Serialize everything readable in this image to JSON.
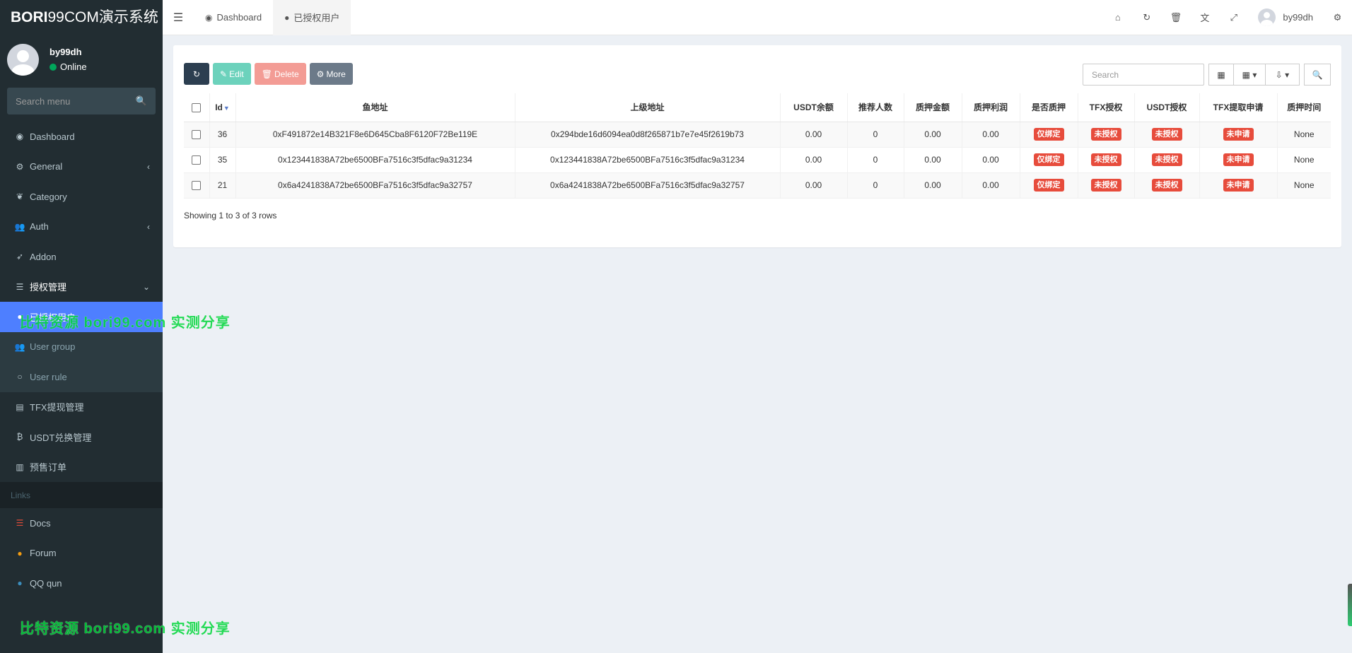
{
  "brand": {
    "bold": "BORI",
    "rest": "99COM演示系统"
  },
  "user": {
    "name": "by99dh",
    "status": "Online"
  },
  "sidebar": {
    "search_placeholder": "Search menu",
    "items": [
      {
        "label": "Dashboard",
        "icon": "dashboard-icon",
        "glyph": "◉"
      },
      {
        "label": "General",
        "icon": "cogs-icon",
        "glyph": "⚙",
        "caret": "‹"
      },
      {
        "label": "Category",
        "icon": "leaf-icon",
        "glyph": "❦"
      },
      {
        "label": "Auth",
        "icon": "users-icon",
        "glyph": "👥",
        "caret": "‹"
      },
      {
        "label": "Addon",
        "icon": "rocket-icon",
        "glyph": "➶"
      },
      {
        "label": "授权管理",
        "icon": "list-icon",
        "glyph": "☰",
        "caret": "⌄"
      }
    ],
    "sub_items": [
      {
        "label": "已授权用户",
        "icon": "user-icon",
        "glyph": "●"
      },
      {
        "label": "User group",
        "icon": "group-icon",
        "glyph": "👥"
      },
      {
        "label": "User rule",
        "icon": "circle-icon",
        "glyph": "○"
      }
    ],
    "items2": [
      {
        "label": "TFX提现管理",
        "icon": "id-card-icon",
        "glyph": "▤"
      },
      {
        "label": "USDT兑换管理",
        "icon": "bitcoin-icon",
        "glyph": "₿"
      },
      {
        "label": "预售订单",
        "icon": "barcode-icon",
        "glyph": "▥"
      }
    ],
    "links_header": "Links",
    "links": [
      {
        "label": "Docs",
        "icon": "docs-icon",
        "glyph": "☰",
        "color": "#dd4b39"
      },
      {
        "label": "Forum",
        "icon": "comment-icon",
        "glyph": "●",
        "color": "#f39c12"
      },
      {
        "label": "QQ qun",
        "icon": "qq-icon",
        "glyph": "●",
        "color": "#3c8dbc"
      }
    ]
  },
  "watermark": "比特资源 bori99.com 实测分享",
  "topnav": {
    "tabs": [
      {
        "label": "Dashboard",
        "icon": "dashboard-icon",
        "glyph": "◉"
      },
      {
        "label": "已授权用户",
        "icon": "user-icon",
        "glyph": "●"
      }
    ],
    "username": "by99dh"
  },
  "toolbar": {
    "edit": "Edit",
    "delete": "Delete",
    "more": "More",
    "search_placeholder": "Search"
  },
  "table": {
    "columns": [
      "Id",
      "鱼地址",
      "上级地址",
      "USDT余额",
      "推荐人数",
      "质押金额",
      "质押利润",
      "是否质押",
      "TFX授权",
      "USDT授权",
      "TFX提取申请",
      "质押时间"
    ],
    "rows": [
      {
        "id": "36",
        "addr": "0xF491872e14B321F8e6D645Cba8F6120F72Be119E",
        "parent": "0x294bde16d6094ea0d8f265871b7e7e45f2619b73",
        "usdt": "0.00",
        "refs": "0",
        "stake": "0.00",
        "profit": "0.00",
        "staked": "仅绑定",
        "tfx_auth": "未授权",
        "usdt_auth": "未授权",
        "tfx_withdraw": "未申请",
        "stake_time": "None"
      },
      {
        "id": "35",
        "addr": "0x123441838A72be6500BFa7516c3f5dfac9a31234",
        "parent": "0x123441838A72be6500BFa7516c3f5dfac9a31234",
        "usdt": "0.00",
        "refs": "0",
        "stake": "0.00",
        "profit": "0.00",
        "staked": "仅绑定",
        "tfx_auth": "未授权",
        "usdt_auth": "未授权",
        "tfx_withdraw": "未申请",
        "stake_time": "None"
      },
      {
        "id": "21",
        "addr": "0x6a4241838A72be6500BFa7516c3f5dfac9a32757",
        "parent": "0x6a4241838A72be6500BFa7516c3f5dfac9a32757",
        "usdt": "0.00",
        "refs": "0",
        "stake": "0.00",
        "profit": "0.00",
        "staked": "仅绑定",
        "tfx_auth": "未授权",
        "usdt_auth": "未授权",
        "tfx_withdraw": "未申请",
        "stake_time": "None"
      }
    ],
    "footer": "Showing 1 to 3 of 3 rows"
  }
}
